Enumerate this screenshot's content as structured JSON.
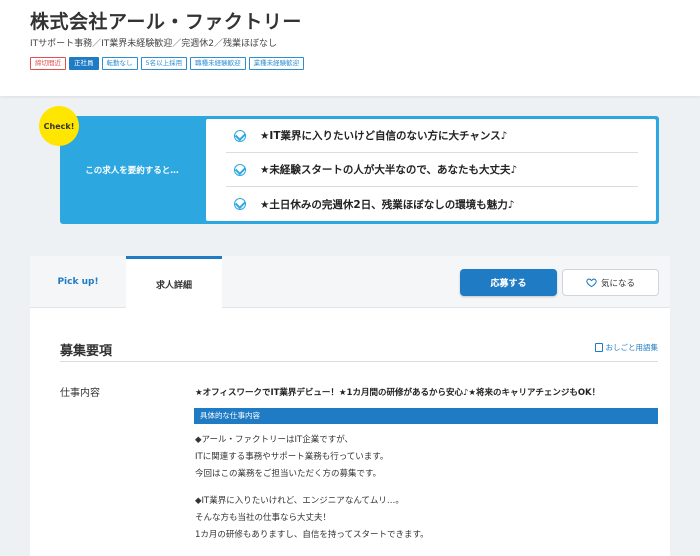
{
  "header": {
    "company": "株式会社アール・ファクトリー",
    "subtitle": "ITサポート事務／IT業界未経験歓迎／完週休2／残業ほぼなし",
    "tags": [
      {
        "label": "締切間近",
        "style": "red"
      },
      {
        "label": "正社員",
        "style": "solid"
      },
      {
        "label": "転勤なし",
        "style": "outline"
      },
      {
        "label": "5名以上採用",
        "style": "outline"
      },
      {
        "label": "職種未経験歓迎",
        "style": "outline"
      },
      {
        "label": "業種未経験歓迎",
        "style": "outline"
      }
    ]
  },
  "summary": {
    "badge": "Check!",
    "label": "この求人を要約すると…",
    "items": [
      "★IT業界に入りたいけど自信のない方に大チャンス♪",
      "★未経験スタートの人が大半なので、あなたも大丈夫♪",
      "★土日休みの完週休2日、残業ほぼなしの環境も魅力♪"
    ]
  },
  "tabs": {
    "pickup": "Pick up!",
    "detail": "求人詳細",
    "apply": "応募する",
    "favorite": "気になる"
  },
  "section": {
    "title": "募集要項",
    "glossary": "おしごと用語集",
    "row_label": "仕事内容",
    "headline": "★オフィスワークでIT業界デビュー！★1カ月間の研修があるから安心♪★将来のキャリアチェンジもOK！",
    "bar": "具体的な仕事内容",
    "lines": [
      "◆アール・ファクトリーはIT企業ですが、",
      "ITに関連する事務やサポート業務も行っています。",
      "今回はこの業務をご担当いただく方の募集です。",
      "◆IT業界に入りたいけれど、エンジニアなんてムリ…。",
      "そんな方も当社の仕事なら大丈夫！",
      "1カ月の研修もありますし、自信を持ってスタートできます。"
    ]
  },
  "colors": {
    "accent": "#1f7bc4",
    "summary_bg": "#2da7e0",
    "badge": "#ffe600",
    "deadline": "#e15050"
  }
}
